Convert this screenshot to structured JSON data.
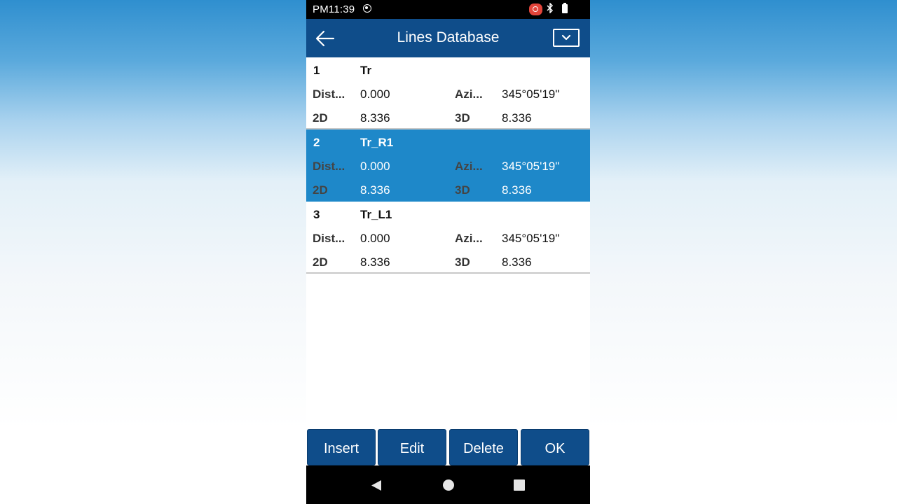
{
  "status_bar": {
    "time": "PM11:39"
  },
  "app_bar": {
    "title": "Lines Database"
  },
  "lines": [
    {
      "index": "1",
      "name": "Tr",
      "dist_label": "Dist...",
      "dist_value": "0.000",
      "azi_label": "Azi...",
      "azi_value": "345°05'19\"",
      "d2_label": "2D",
      "d2_value": "8.336",
      "d3_label": "3D",
      "d3_value": "8.336",
      "selected": false
    },
    {
      "index": "2",
      "name": "Tr_R1",
      "dist_label": "Dist...",
      "dist_value": "0.000",
      "azi_label": "Azi...",
      "azi_value": "345°05'19\"",
      "d2_label": "2D",
      "d2_value": "8.336",
      "d3_label": "3D",
      "d3_value": "8.336",
      "selected": true
    },
    {
      "index": "3",
      "name": "Tr_L1",
      "dist_label": "Dist...",
      "dist_value": "0.000",
      "azi_label": "Azi...",
      "azi_value": "345°05'19\"",
      "d2_label": "2D",
      "d2_value": "8.336",
      "d3_label": "3D",
      "d3_value": "8.336",
      "selected": false
    }
  ],
  "buttons": {
    "insert": "Insert",
    "edit": "Edit",
    "delete": "Delete",
    "ok": "OK"
  },
  "colors": {
    "app_bar": "#0f4d8a",
    "selected_row": "#1e88c9",
    "button": "#0f4d8a"
  }
}
